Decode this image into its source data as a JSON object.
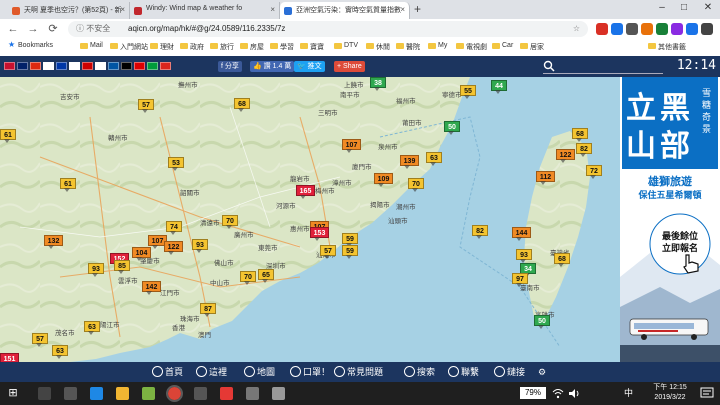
{
  "browser": {
    "tabs": [
      {
        "title": "天啊 夏季也空污？(第52頁) - 新",
        "active": false,
        "favicon_color": "#e05a2a"
      },
      {
        "title": "Windy: Wind map & weather fo",
        "active": false,
        "favicon_color": "#c1272d"
      },
      {
        "title": "亞洲空氣污染：實時空氣質量指數",
        "active": true,
        "favicon_color": "#2a6fd6"
      }
    ],
    "new_tab": "+",
    "window_controls": {
      "minimize": "–",
      "maximize": "□",
      "close": "✕"
    },
    "nav": {
      "back": "←",
      "forward": "→",
      "reload": "⟳"
    },
    "address": {
      "security": "ⓘ 不安全",
      "url": "aqicn.org/map/hk/#@g/24.0589/116.2335/7z",
      "star": "☆"
    },
    "bookmarks": [
      "Bookmarks",
      "Mail",
      "入門網站",
      "理財",
      "政府",
      "旅行",
      "房屋",
      "學習",
      "寶寶",
      "DTV",
      "休閒",
      "醫院",
      "My",
      "電視劇",
      "Car",
      "居家",
      "其他書籤"
    ]
  },
  "site": {
    "share_labels": {
      "share": "分享",
      "like": "讚 1.4 萬",
      "tweet": "推文",
      "plus": "Share"
    },
    "clock": "12:14",
    "flag_colors": [
      "#c8102e",
      "#012169",
      "#de2910",
      "#ffffff",
      "#0038a8",
      "#ffffff",
      "#cc0000",
      "#ffffff",
      "#0055a4",
      "#000000",
      "#dd0000",
      "#009c3b",
      "#da251d"
    ]
  },
  "map": {
    "stations": [
      {
        "v": "57",
        "c": "#f4c430"
      },
      {
        "v": "68",
        "c": "#f4c430"
      },
      {
        "v": "38",
        "c": "#2fa84f"
      },
      {
        "v": "44",
        "c": "#2fa84f"
      },
      {
        "v": "55",
        "c": "#f4c430"
      },
      {
        "v": "61",
        "c": "#f4c430"
      },
      {
        "v": "50",
        "c": "#2fa84f"
      },
      {
        "v": "68",
        "c": "#f4c430"
      },
      {
        "v": "107",
        "c": "#f08a24"
      },
      {
        "v": "53",
        "c": "#f4c430"
      },
      {
        "v": "139",
        "c": "#f08a24"
      },
      {
        "v": "63",
        "c": "#f4c430"
      },
      {
        "v": "122",
        "c": "#f08a24"
      },
      {
        "v": "82",
        "c": "#f4c430"
      },
      {
        "v": "72",
        "c": "#f4c430"
      },
      {
        "v": "109",
        "c": "#f08a24"
      },
      {
        "v": "70",
        "c": "#f4c430"
      },
      {
        "v": "112",
        "c": "#f08a24"
      },
      {
        "v": "61",
        "c": "#f4c430"
      },
      {
        "v": "165",
        "c": "#e0203a"
      },
      {
        "v": "74",
        "c": "#f4c430"
      },
      {
        "v": "70",
        "c": "#f4c430"
      },
      {
        "v": "107",
        "c": "#f08a24"
      },
      {
        "v": "59",
        "c": "#f4c430"
      },
      {
        "v": "132",
        "c": "#f08a24"
      },
      {
        "v": "107",
        "c": "#f08a24"
      },
      {
        "v": "122",
        "c": "#f08a24"
      },
      {
        "v": "93",
        "c": "#f4c430"
      },
      {
        "v": "153",
        "c": "#e0203a"
      },
      {
        "v": "57",
        "c": "#f4c430"
      },
      {
        "v": "59",
        "c": "#f4c430"
      },
      {
        "v": "82",
        "c": "#f4c430"
      },
      {
        "v": "144",
        "c": "#f08a24"
      },
      {
        "v": "152",
        "c": "#e0203a"
      },
      {
        "v": "104",
        "c": "#f08a24"
      },
      {
        "v": "93",
        "c": "#f4c430"
      },
      {
        "v": "70",
        "c": "#f4c430"
      },
      {
        "v": "65",
        "c": "#f4c430"
      },
      {
        "v": "93",
        "c": "#f4c430"
      },
      {
        "v": "34",
        "c": "#2fa84f"
      },
      {
        "v": "68",
        "c": "#f4c430"
      },
      {
        "v": "85",
        "c": "#f4c430"
      },
      {
        "v": "142",
        "c": "#f08a24"
      },
      {
        "v": "97",
        "c": "#f4c430"
      },
      {
        "v": "63",
        "c": "#f4c430"
      },
      {
        "v": "57",
        "c": "#f4c430"
      },
      {
        "v": "63",
        "c": "#f4c430"
      },
      {
        "v": "50",
        "c": "#2fa84f"
      },
      {
        "v": "87",
        "c": "#f4c430"
      },
      {
        "v": "151",
        "c": "#e0203a"
      }
    ],
    "cities": [
      "贛州市",
      "梅州市",
      "汕頭市",
      "潮州市",
      "廣州市",
      "東莞市",
      "深圳市",
      "香港",
      "珠海市",
      "高雄市",
      "臺南市",
      "臺灣省",
      "福州市",
      "廈門市",
      "漳州市",
      "龍岩市",
      "泉州市",
      "莆田市",
      "三明市",
      "韶關市",
      "河源市",
      "清遠市",
      "惠州市",
      "汕尾市",
      "揭陽市",
      "江門市",
      "中山市",
      "澳門",
      "陽江市",
      "茂名市",
      "雲浮市",
      "肇慶市",
      "佛山市",
      "南平市",
      "寧德市",
      "上饒市",
      "撫州市",
      "吉安市"
    ]
  },
  "ad": {
    "title_chars": [
      "立",
      "黑",
      "山",
      "部"
    ],
    "side_chars": [
      "雪",
      "糖",
      "奇",
      "景"
    ],
    "headline": "雄獅旅遊",
    "subline": "保住五星希爾頓",
    "bubble1": "最後餘位",
    "bubble2": "立即報名",
    "brand_color": "#0b6fc4"
  },
  "bottom_nav": [
    {
      "label": "首頁"
    },
    {
      "label": "這裡"
    },
    {
      "label": "地圖"
    },
    {
      "label": "口罩！"
    },
    {
      "label": "常見問題"
    },
    {
      "label": "搜索"
    },
    {
      "label": "聯繫"
    },
    {
      "label": "鏈接"
    },
    {
      "label": "⚙"
    }
  ],
  "taskbar": {
    "start": "⊞",
    "battery": "79%",
    "time": "下午 12:15",
    "date": "2019/3/22",
    "ime": "中",
    "apps": [
      {
        "name": "search",
        "color": "#444"
      },
      {
        "name": "task-view",
        "color": "#555"
      },
      {
        "name": "edge",
        "color": "#1e88e5"
      },
      {
        "name": "file-explorer",
        "color": "#f2b632"
      },
      {
        "name": "store",
        "color": "#7cb342"
      },
      {
        "name": "chrome",
        "color": "#db4437"
      },
      {
        "name": "app7",
        "color": "#555"
      },
      {
        "name": "app8",
        "color": "#e53935"
      },
      {
        "name": "app9",
        "color": "#777"
      },
      {
        "name": "app10",
        "color": "#999"
      }
    ]
  }
}
